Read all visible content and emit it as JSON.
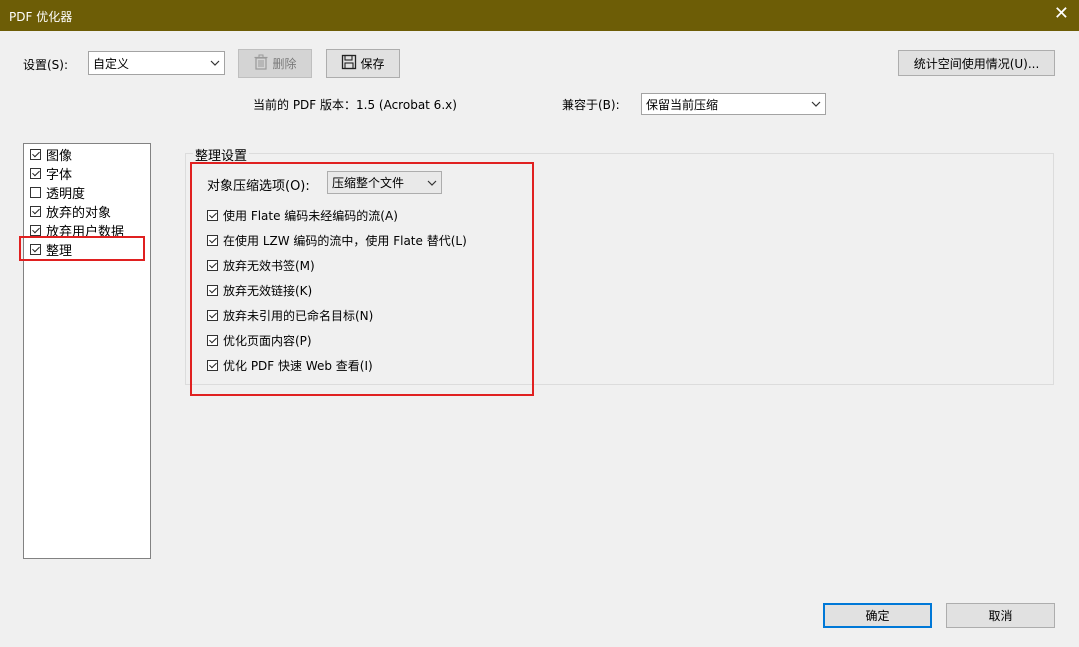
{
  "window": {
    "title": "PDF 优化器",
    "close_symbol": "✕"
  },
  "settings": {
    "label": "设置(S):",
    "value": "自定义",
    "delete_label": "删除",
    "save_label": "保存",
    "stats_label": "统计空间使用情况(U)..."
  },
  "info": {
    "version_label": "当前的 PDF 版本：1.5 (Acrobat 6.x)",
    "compat_label": "兼容于(B):",
    "compat_value": "保留当前压缩"
  },
  "categories": [
    {
      "label": "图像",
      "checked": true
    },
    {
      "label": "字体",
      "checked": true
    },
    {
      "label": "透明度",
      "checked": false
    },
    {
      "label": "放弃的对象",
      "checked": true
    },
    {
      "label": "放弃用户数据",
      "checked": true
    },
    {
      "label": "整理",
      "checked": true
    }
  ],
  "cleanup": {
    "group_title": "整理设置",
    "compression_label": "对象压缩选项(O):",
    "compression_value": "压缩整个文件",
    "options": [
      {
        "label": "使用 Flate 编码未经编码的流(A)",
        "checked": true
      },
      {
        "label": "在使用 LZW 编码的流中，使用 Flate 替代(L)",
        "checked": true
      },
      {
        "label": "放弃无效书签(M)",
        "checked": true
      },
      {
        "label": "放弃无效链接(K)",
        "checked": true
      },
      {
        "label": "放弃未引用的已命名目标(N)",
        "checked": true
      },
      {
        "label": "优化页面内容(P)",
        "checked": true
      },
      {
        "label": "优化 PDF 快速 Web 查看(I)",
        "checked": true
      }
    ]
  },
  "footer": {
    "ok_label": "确定",
    "cancel_label": "取消"
  },
  "colors": {
    "titlebar": "#6d5d06",
    "highlight": "#e02020",
    "primary_border": "#0078d7"
  }
}
